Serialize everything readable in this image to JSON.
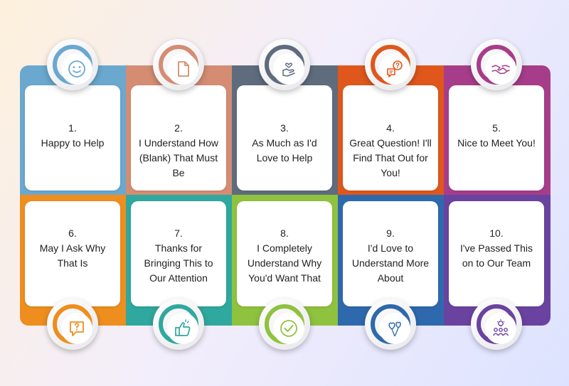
{
  "items": [
    {
      "number": "1.",
      "text": "Happy to Help",
      "color": "#6aa8cf",
      "icon": "smiley-icon"
    },
    {
      "number": "2.",
      "text": "I Understand How (Blank) That Must Be",
      "color": "#d48d73",
      "icon": "document-icon"
    },
    {
      "number": "3.",
      "text": "As Much as I'd Love to Help",
      "color": "#5e6c7d",
      "icon": "heart-hand-icon"
    },
    {
      "number": "4.",
      "text": "Great Question! I'll Find That Out for You!",
      "color": "#e0571c",
      "icon": "question-chat-icon"
    },
    {
      "number": "5.",
      "text": "Nice to Meet You!",
      "color": "#a73d8a",
      "icon": "handshake-icon"
    },
    {
      "number": "6.",
      "text": "May I Ask Why That Is",
      "color": "#ee8e1e",
      "icon": "question-bubble-icon"
    },
    {
      "number": "7.",
      "text": "Thanks for Bringing This to Our Attention",
      "color": "#2fa89f",
      "icon": "thumbs-up-icon"
    },
    {
      "number": "8.",
      "text": "I Completely Understand Why You'd Want That",
      "color": "#8fc23f",
      "icon": "check-circle-icon"
    },
    {
      "number": "9.",
      "text": "I'd Love to Understand More About",
      "color": "#2f69ad",
      "icon": "balloons-icon"
    },
    {
      "number": "10.",
      "text": "I've Passed This on to Our Team",
      "color": "#6a43a0",
      "icon": "team-idea-icon"
    }
  ]
}
